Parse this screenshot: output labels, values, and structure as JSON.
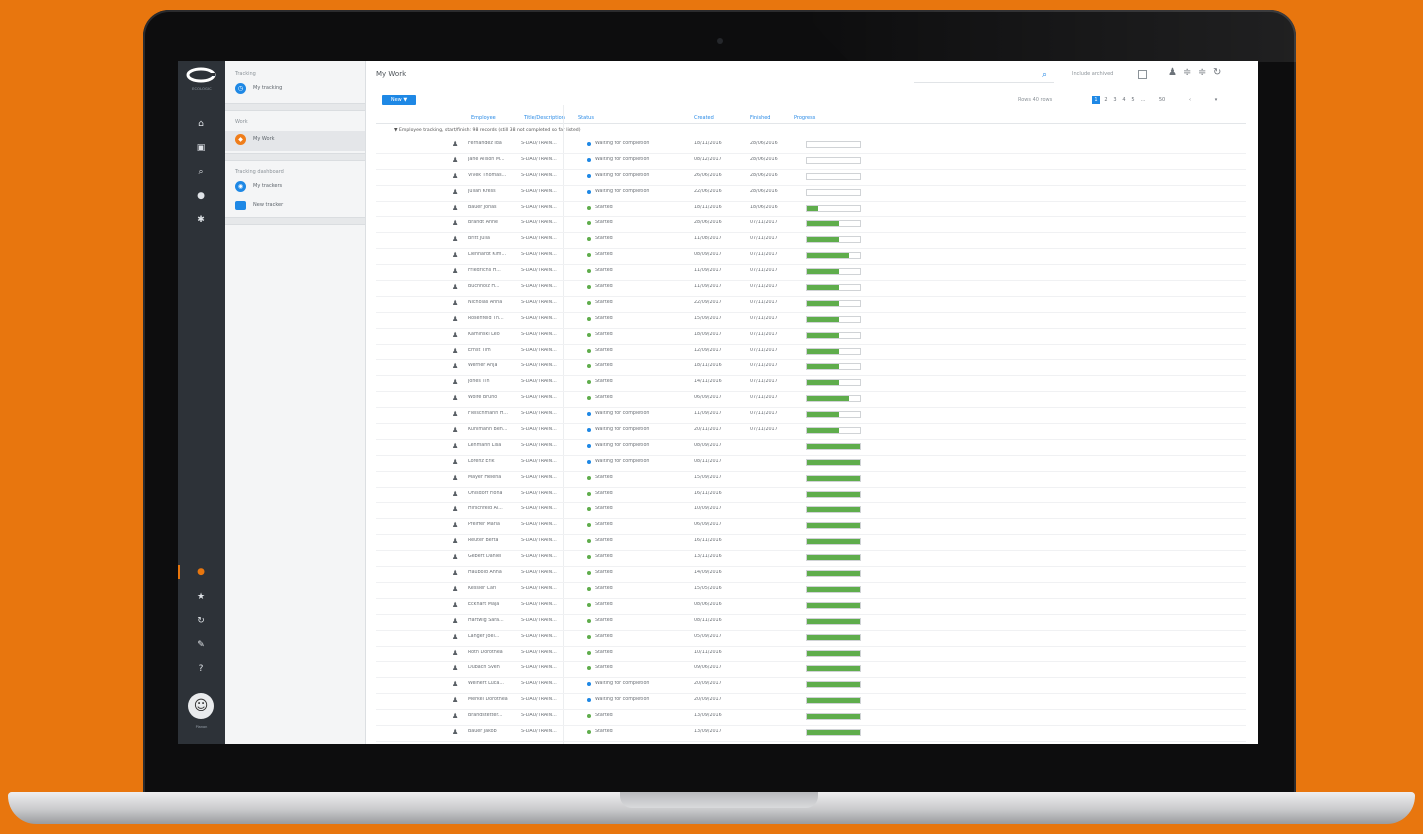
{
  "colors": {
    "background": "#e8760e",
    "accent": "#1e88e5",
    "progress": "#5fad4c",
    "rail": "#2d3238"
  },
  "rail": {
    "brand": "ECOLOGIC",
    "footer": "Planon",
    "icons": [
      "home-icon",
      "inbox-icon",
      "search-icon",
      "bug-icon",
      "settings-icon",
      "orange-dot-icon",
      "star-icon",
      "history-icon",
      "tag-icon",
      "help-icon"
    ]
  },
  "nav": {
    "groups": [
      {
        "head": "Tracking",
        "items": [
          {
            "label": "My tracking",
            "icon": "clock-icon"
          }
        ]
      },
      {
        "head": "Work",
        "items": [
          {
            "label": "My Work",
            "icon": "briefcase-icon"
          }
        ]
      },
      {
        "head": "Tracking dashboard",
        "items": [
          {
            "label": "My trackers",
            "icon": "tracker-icon"
          },
          {
            "label": "New tracker",
            "icon": "plus-icon"
          }
        ]
      }
    ]
  },
  "main": {
    "title": "My Work",
    "include_label": "Include archived",
    "new_button": "New ▼",
    "rows_per_page": "Rows 40 rows",
    "pages": [
      "1",
      "2",
      "3",
      "4",
      "5",
      "...",
      "50"
    ],
    "columns": [
      "Employee",
      "Title/Description",
      "Status",
      "Created",
      "Finished",
      "Progress"
    ],
    "group_line": "▼ Employee tracking, start/finish: 98 records (still 38 not completed so far listed)"
  },
  "table": {
    "rows": [
      {
        "name": "Fernandez Ida",
        "desc": "S-DAU/TRAIN...",
        "status": "Waiting for completion",
        "status_color": "#1e88e5",
        "created": "18/11/2016",
        "finished": "28/06/2016",
        "progress": 0
      },
      {
        "name": "Jane Alison M...",
        "desc": "S-DAU/TRAIN...",
        "status": "Waiting for completion",
        "status_color": "#1e88e5",
        "created": "08/12/2017",
        "finished": "28/06/2016",
        "progress": 0
      },
      {
        "name": "Vivek Thomas...",
        "desc": "S-DAU/TRAIN...",
        "status": "Waiting for completion",
        "status_color": "#1e88e5",
        "created": "26/06/2016",
        "finished": "28/06/2016",
        "progress": 0
      },
      {
        "name": "Julian Kress",
        "desc": "S-DAU/TRAIN...",
        "status": "Waiting for completion",
        "status_color": "#1e88e5",
        "created": "22/06/2016",
        "finished": "28/06/2016",
        "progress": 0
      },
      {
        "name": "Bauer Jonas",
        "desc": "S-DAU/TRAIN...",
        "status": "Started",
        "status_color": "#5fad4c",
        "created": "18/11/2016",
        "finished": "18/06/2016",
        "progress": 0.2
      },
      {
        "name": "Brandt Anne",
        "desc": "S-DAU/TRAIN...",
        "status": "Started",
        "status_color": "#5fad4c",
        "created": "28/06/2016",
        "finished": "07/11/2017",
        "progress": 0.6
      },
      {
        "name": "Britt Julia",
        "desc": "S-DAU/TRAIN...",
        "status": "Started",
        "status_color": "#5fad4c",
        "created": "11/08/2017",
        "finished": "07/11/2017",
        "progress": 0.6
      },
      {
        "name": "Lienhardt Kim...",
        "desc": "S-DAU/TRAIN...",
        "status": "Started",
        "status_color": "#5fad4c",
        "created": "08/09/2017",
        "finished": "07/11/2017",
        "progress": 0.8
      },
      {
        "name": "Friedrichs H...",
        "desc": "S-DAU/TRAIN...",
        "status": "Started",
        "status_color": "#5fad4c",
        "created": "11/09/2017",
        "finished": "07/11/2017",
        "progress": 0.6
      },
      {
        "name": "Buchholz H...",
        "desc": "S-DAU/TRAIN...",
        "status": "Started",
        "status_color": "#5fad4c",
        "created": "11/09/2017",
        "finished": "07/11/2017",
        "progress": 0.6
      },
      {
        "name": "Nicholas Anna",
        "desc": "S-DAU/TRAIN...",
        "status": "Started",
        "status_color": "#5fad4c",
        "created": "22/09/2017",
        "finished": "07/11/2017",
        "progress": 0.6
      },
      {
        "name": "Rosenfeld Th...",
        "desc": "S-DAU/TRAIN...",
        "status": "Started",
        "status_color": "#5fad4c",
        "created": "15/09/2017",
        "finished": "07/11/2017",
        "progress": 0.6
      },
      {
        "name": "Kaminski Leo",
        "desc": "S-DAU/TRAIN...",
        "status": "Started",
        "status_color": "#5fad4c",
        "created": "18/09/2017",
        "finished": "07/11/2017",
        "progress": 0.6
      },
      {
        "name": "Ernst Tim",
        "desc": "S-DAU/TRAIN...",
        "status": "Started",
        "status_color": "#5fad4c",
        "created": "12/09/2017",
        "finished": "07/11/2017",
        "progress": 0.6
      },
      {
        "name": "Werner Anja",
        "desc": "S-DAU/TRAIN...",
        "status": "Started",
        "status_color": "#5fad4c",
        "created": "18/11/2016",
        "finished": "07/11/2017",
        "progress": 0.6
      },
      {
        "name": "Jones Tin",
        "desc": "S-DAU/TRAIN...",
        "status": "Started",
        "status_color": "#5fad4c",
        "created": "14/11/2016",
        "finished": "07/11/2017",
        "progress": 0.6
      },
      {
        "name": "Wolfe Bruno",
        "desc": "S-DAU/TRAIN...",
        "status": "Started",
        "status_color": "#5fad4c",
        "created": "06/09/2017",
        "finished": "07/11/2017",
        "progress": 0.8
      },
      {
        "name": "Fleischmann H...",
        "desc": "S-DAU/TRAIN...",
        "status": "Waiting for completion",
        "status_color": "#1e88e5",
        "created": "11/09/2017",
        "finished": "07/11/2017",
        "progress": 0.6
      },
      {
        "name": "Kuhlmann Ben...",
        "desc": "S-DAU/TRAIN...",
        "status": "Waiting for completion",
        "status_color": "#1e88e5",
        "created": "20/11/2017",
        "finished": "07/11/2017",
        "progress": 0.6
      },
      {
        "name": "Lehmann Lisa",
        "desc": "S-DAU/TRAIN...",
        "status": "Waiting for completion",
        "status_color": "#1e88e5",
        "created": "08/09/2017",
        "finished": "",
        "progress": 1
      },
      {
        "name": "Lorenz Erik",
        "desc": "S-DAU/TRAIN...",
        "status": "Waiting for completion",
        "status_color": "#1e88e5",
        "created": "08/11/2017",
        "finished": "",
        "progress": 1
      },
      {
        "name": "Mayer Helena",
        "desc": "S-DAU/TRAIN...",
        "status": "Started",
        "status_color": "#5fad4c",
        "created": "15/09/2017",
        "finished": "",
        "progress": 1
      },
      {
        "name": "Ohlsdorf Fiona",
        "desc": "S-DAU/TRAIN...",
        "status": "Started",
        "status_color": "#5fad4c",
        "created": "16/11/2016",
        "finished": "",
        "progress": 1
      },
      {
        "name": "Hirschfeld Al...",
        "desc": "S-DAU/TRAIN...",
        "status": "Started",
        "status_color": "#5fad4c",
        "created": "10/09/2017",
        "finished": "",
        "progress": 1
      },
      {
        "name": "Pfeiffer Maria",
        "desc": "S-DAU/TRAIN...",
        "status": "Started",
        "status_color": "#5fad4c",
        "created": "06/09/2017",
        "finished": "",
        "progress": 1
      },
      {
        "name": "Reuter Berta",
        "desc": "S-DAU/TRAIN...",
        "status": "Started",
        "status_color": "#5fad4c",
        "created": "16/11/2016",
        "finished": "",
        "progress": 1
      },
      {
        "name": "Gebert Daniel",
        "desc": "S-DAU/TRAIN...",
        "status": "Started",
        "status_color": "#5fad4c",
        "created": "13/11/2016",
        "finished": "",
        "progress": 1
      },
      {
        "name": "Haubold Anna",
        "desc": "S-DAU/TRAIN...",
        "status": "Started",
        "status_color": "#5fad4c",
        "created": "14/09/2016",
        "finished": "",
        "progress": 1
      },
      {
        "name": "Kessler Carl",
        "desc": "S-DAU/TRAIN...",
        "status": "Started",
        "status_color": "#5fad4c",
        "created": "15/05/2016",
        "finished": "",
        "progress": 1
      },
      {
        "name": "Eckhart Maja",
        "desc": "S-DAU/TRAIN...",
        "status": "Started",
        "status_color": "#5fad4c",
        "created": "08/06/2016",
        "finished": "",
        "progress": 1
      },
      {
        "name": "Hartwig Sara...",
        "desc": "S-DAU/TRAIN...",
        "status": "Started",
        "status_color": "#5fad4c",
        "created": "08/11/2016",
        "finished": "",
        "progress": 1
      },
      {
        "name": "Langer Joel...",
        "desc": "S-DAU/TRAIN...",
        "status": "Started",
        "status_color": "#5fad4c",
        "created": "05/09/2017",
        "finished": "",
        "progress": 1
      },
      {
        "name": "Roth Dorothea",
        "desc": "S-DAU/TRAIN...",
        "status": "Started",
        "status_color": "#5fad4c",
        "created": "10/11/2016",
        "finished": "",
        "progress": 1
      },
      {
        "name": "Dubach Sven",
        "desc": "S-DAU/TRAIN...",
        "status": "Started",
        "status_color": "#5fad4c",
        "created": "09/06/2017",
        "finished": "",
        "progress": 1
      },
      {
        "name": "Weinert Luca...",
        "desc": "S-DAU/TRAIN...",
        "status": "Waiting for completion",
        "status_color": "#1e88e5",
        "created": "20/09/2017",
        "finished": "",
        "progress": 1
      },
      {
        "name": "Merkel Dorothea",
        "desc": "S-DAU/TRAIN...",
        "status": "Waiting for completion",
        "status_color": "#1e88e5",
        "created": "20/09/2017",
        "finished": "",
        "progress": 1
      },
      {
        "name": "Brandstetter...",
        "desc": "S-DAU/TRAIN...",
        "status": "Started",
        "status_color": "#5fad4c",
        "created": "13/09/2016",
        "finished": "",
        "progress": 1
      },
      {
        "name": "Bauer Jakob",
        "desc": "S-DAU/TRAIN...",
        "status": "Started",
        "status_color": "#5fad4c",
        "created": "13/09/2017",
        "finished": "",
        "progress": 1
      },
      {
        "name": "Pohl Darius",
        "desc": "S-DAU/TRAIN...",
        "status": "Waiting for completion",
        "status_color": "#1e88e5",
        "created": "15/11/2017",
        "finished": "",
        "progress": 1
      },
      {
        "name": "Rottmann Lua...",
        "desc": "S-DAU/TRAIN...",
        "status": "Waiting for completion",
        "status_color": "#1e88e5",
        "created": "20/09/2017",
        "finished": "",
        "progress": 1
      }
    ]
  }
}
